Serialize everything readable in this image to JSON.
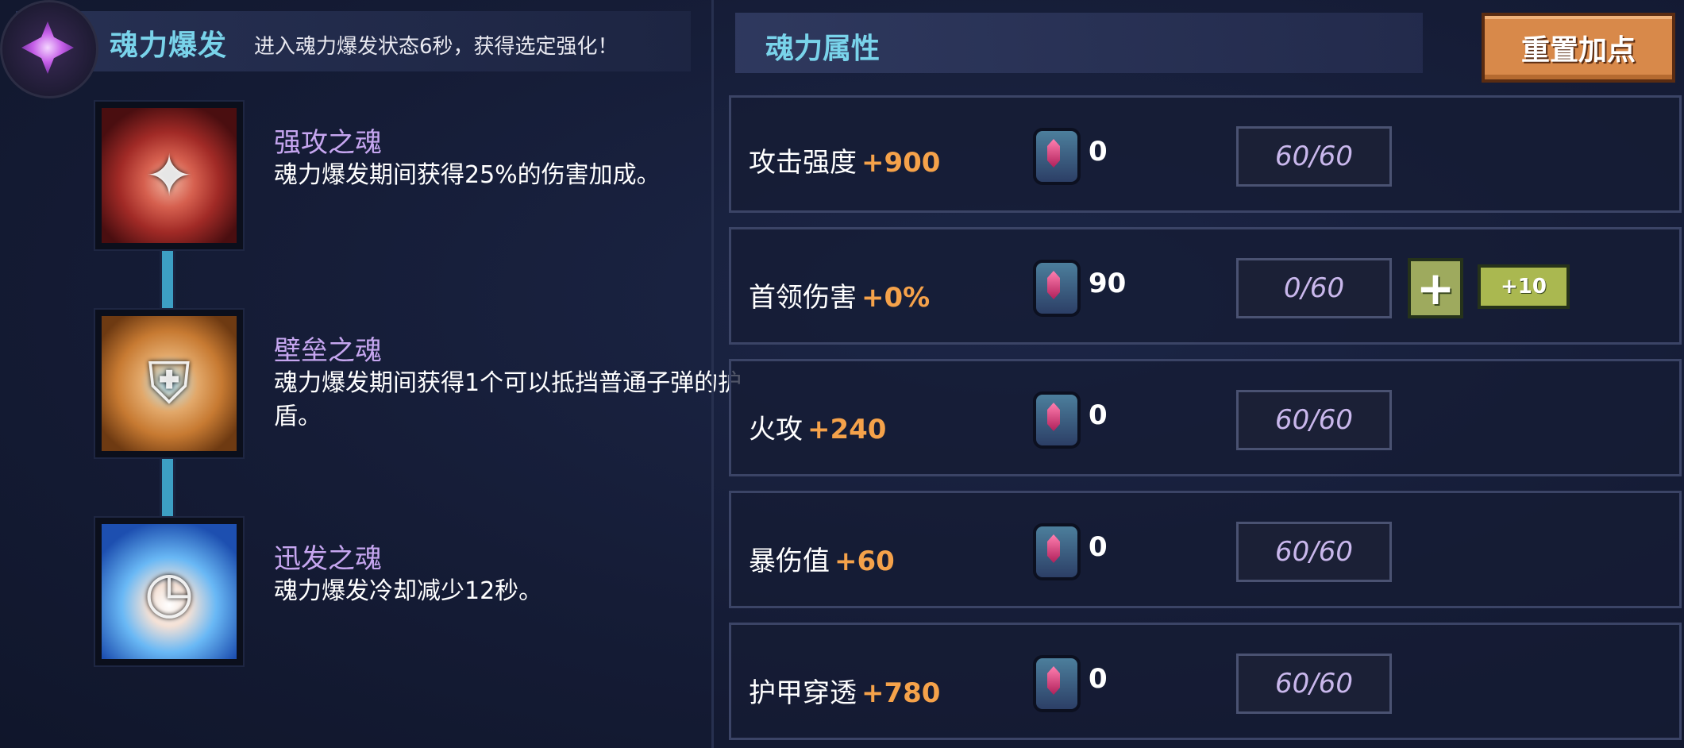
{
  "burst": {
    "title": "魂力爆发",
    "description": "进入魂力爆发状态6秒，获得选定强化！"
  },
  "souls": [
    {
      "name": "强攻之魂",
      "description": "魂力爆发期间获得25%的伤害加成。"
    },
    {
      "name": "壁垒之魂",
      "description": "魂力爆发期间获得1个可以抵挡普通子弹的护盾。"
    },
    {
      "name": "迅发之魂",
      "description": "魂力爆发冷却减少12秒。"
    }
  ],
  "attributes_panel": {
    "title": "魂力属性",
    "reset_label": "重置加点"
  },
  "attributes": [
    {
      "name": "攻击强度",
      "bonus": "+900",
      "gems": "0",
      "progress": "60/60"
    },
    {
      "name": "首领伤害",
      "bonus": "+0%",
      "gems": "90",
      "progress": "0/60",
      "plus_label": "+",
      "plus10_label": "+10"
    },
    {
      "name": "火攻",
      "bonus": "+240",
      "gems": "0",
      "progress": "60/60"
    },
    {
      "name": "暴伤值",
      "bonus": "+60",
      "gems": "0",
      "progress": "60/60"
    },
    {
      "name": "护甲穿透",
      "bonus": "+780",
      "gems": "0",
      "progress": "60/60"
    }
  ],
  "colors": {
    "accent_title": "#79d3ea",
    "soul_name": "#c6a6f0",
    "bonus": "#f5a24a",
    "reset_button": "#d8894a",
    "plus_button": "#9eaa5e"
  },
  "icons": [
    "burst-emblem-icon",
    "strong-soul-icon",
    "fortress-soul-icon",
    "swift-soul-icon",
    "soul-gem-icon",
    "plus-icon"
  ]
}
